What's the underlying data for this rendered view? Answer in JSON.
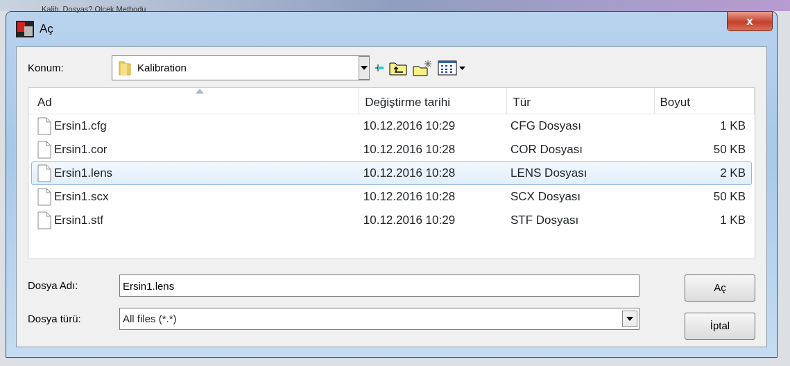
{
  "background_window": {
    "title": "Kalib. Dosyas? Olcek Methodu"
  },
  "window": {
    "title": "Aç",
    "close": "x"
  },
  "location": {
    "label": "Konum:",
    "value": "Kalibration"
  },
  "table": {
    "columns": [
      {
        "label": "Ad",
        "sorted": true
      },
      {
        "label": "Değiştirme tarihi",
        "sorted": false
      },
      {
        "label": "Tür",
        "sorted": false
      },
      {
        "label": "Boyut",
        "sorted": false
      }
    ],
    "rows": [
      {
        "name": "Ersin1.cfg",
        "date": "10.12.2016 10:29",
        "type": "CFG Dosyası",
        "size": "1 KB",
        "selected": false
      },
      {
        "name": "Ersin1.cor",
        "date": "10.12.2016 10:28",
        "type": "COR Dosyası",
        "size": "50 KB",
        "selected": false
      },
      {
        "name": "Ersin1.lens",
        "date": "10.12.2016 10:28",
        "type": "LENS Dosyası",
        "size": "2 KB",
        "selected": true
      },
      {
        "name": "Ersin1.scx",
        "date": "10.12.2016 10:28",
        "type": "SCX Dosyası",
        "size": "50 KB",
        "selected": false
      },
      {
        "name": "Ersin1.stf",
        "date": "10.12.2016 10:29",
        "type": "STF Dosyası",
        "size": "1 KB",
        "selected": false
      }
    ]
  },
  "file_name": {
    "label": "Dosya Adı:",
    "value": "Ersin1.lens"
  },
  "file_type": {
    "label": "Dosya türü:",
    "value": "All files (*.*)"
  },
  "buttons": [
    "Aç",
    "İptal"
  ]
}
